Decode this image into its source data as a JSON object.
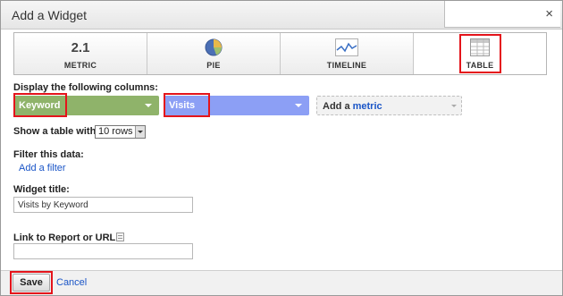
{
  "dialog": {
    "title": "Add a Widget",
    "close_glyph": "×"
  },
  "widget_types": [
    {
      "label": "METRIC",
      "icon": "metric-icon",
      "icon_text": "2.1"
    },
    {
      "label": "PIE",
      "icon": "pie-chart-icon"
    },
    {
      "label": "TIMELINE",
      "icon": "timeline-icon"
    },
    {
      "label": "TABLE",
      "icon": "table-icon",
      "selected": true
    }
  ],
  "columns": {
    "label": "Display the following columns:",
    "dimension": "Keyword",
    "metric1": "Visits",
    "add_metric_prefix": "Add a ",
    "add_metric_link": "metric"
  },
  "rows": {
    "label": "Show a table with",
    "value": "10 rows"
  },
  "filter": {
    "label": "Filter this data:",
    "link": "Add a filter"
  },
  "widget_title": {
    "label": "Widget title:",
    "value": "Visits by Keyword"
  },
  "report_link": {
    "label": "Link to Report or URL:",
    "value": ""
  },
  "footer": {
    "save": "Save",
    "cancel": "Cancel"
  },
  "colors": {
    "dimension_bg": "#8fb36a",
    "metric_bg": "#8c9ff5",
    "link": "#1a55c7",
    "highlight": "#e4141b"
  }
}
